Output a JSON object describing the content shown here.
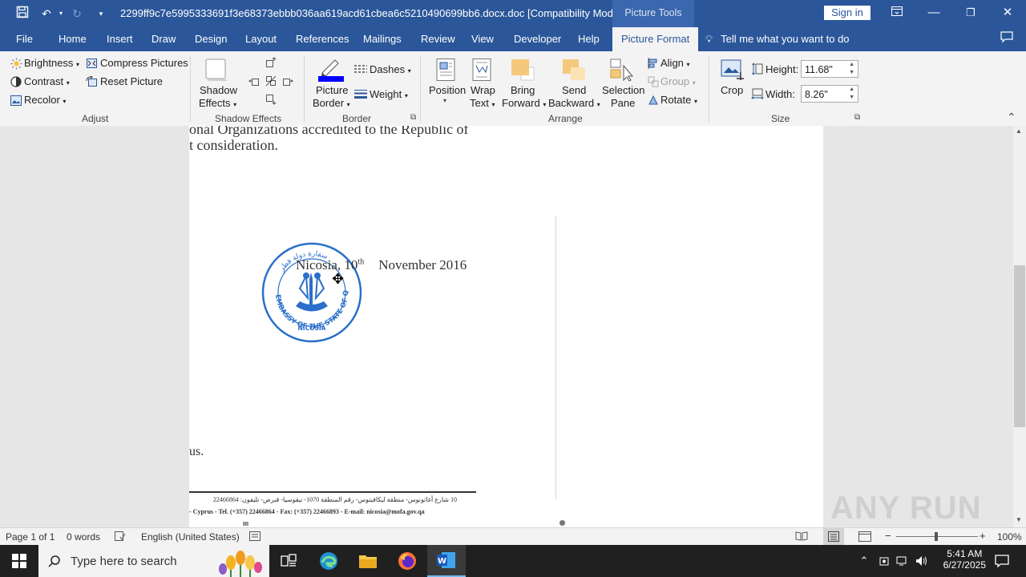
{
  "titlebar": {
    "document_title": "2299ff9c7e5995333691f3e68373ebbb036aa619acd61cbea6c5210490699bb6.docx.doc [Compatibility Mode]  -  Word",
    "context_tab": "Picture Tools",
    "signin": "Sign in"
  },
  "tabs": {
    "file": "File",
    "home": "Home",
    "insert": "Insert",
    "draw": "Draw",
    "design": "Design",
    "layout": "Layout",
    "references": "References",
    "mailings": "Mailings",
    "review": "Review",
    "view": "View",
    "developer": "Developer",
    "help": "Help",
    "picture_format": "Picture Format",
    "tell_me": "Tell me what you want to do"
  },
  "ribbon": {
    "adjust": {
      "brightness": "Brightness",
      "contrast": "Contrast",
      "recolor": "Recolor",
      "compress": "Compress Pictures",
      "reset": "Reset Picture",
      "group": "Adjust"
    },
    "shadow": {
      "shadow_effects": "Shadow",
      "shadow_effects2": "Effects",
      "group": "Shadow Effects"
    },
    "border": {
      "picture_border": "Picture",
      "picture_border2": "Border",
      "dashes": "Dashes",
      "weight": "Weight",
      "group": "Border",
      "border_color": "#0000ff"
    },
    "arrange": {
      "position": "Position",
      "wrap": "Wrap",
      "wrap2": "Text",
      "bring": "Bring",
      "bring2": "Forward",
      "send": "Send",
      "send2": "Backward",
      "selection": "Selection",
      "selection2": "Pane",
      "align": "Align",
      "group_btn": "Group",
      "rotate": "Rotate",
      "group": "Arrange"
    },
    "size": {
      "crop": "Crop",
      "height_label": "Height:",
      "height_value": "11.68\"",
      "width_label": "Width:",
      "width_value": "8.26\"",
      "group": "Size"
    }
  },
  "document": {
    "line1": "onal Organizations accredited to the Republic of",
    "line2": "t consideration.",
    "date_place": "Nicosia, 10",
    "date_sup": "th",
    "date_rest": "November 2016",
    "closing": "us.",
    "footer_arabic": "10 شارع أغاثونوس- منطقة ليكافيتوس- رقم المنطقة 1070- نيقوسيا- قبرص- تليفون: 22466864",
    "footer_english": "- Cyprus  -  Tel.  (+357) 22466864  -  Fax:  (+357) 22466893  -  E-mail: nicosia@mofa.gov.qa",
    "stamp_text": "EMBASSY OF THE STATE OF QATAR",
    "stamp_city": "NICOSIA",
    "stamp_color": "#2a6fc9"
  },
  "statusbar": {
    "page": "Page 1 of 1",
    "words": "0 words",
    "language": "English (United States)",
    "zoom": "100%"
  },
  "taskbar": {
    "search_placeholder": "Type here to search",
    "time": "5:41 AM",
    "date": "6/27/2025"
  },
  "watermark": "ANY RUN"
}
